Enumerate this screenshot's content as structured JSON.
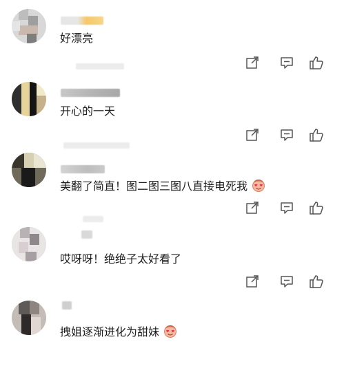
{
  "comments": [
    {
      "text": "好漂亮",
      "emoji": ""
    },
    {
      "text": "开心的一天",
      "emoji": ""
    },
    {
      "text": "美翻了简直！图二图三图八直接电死我",
      "emoji": "heart-eyes-emoji-icon"
    },
    {
      "text": "哎呀呀！绝绝子太好看了",
      "emoji": ""
    },
    {
      "text": "拽姐逐渐进化为甜妹",
      "emoji": "heart-eyes-emoji-icon"
    }
  ],
  "icons": {
    "share": "share-icon",
    "comment": "comment-icon",
    "like": "thumbs-up-icon"
  },
  "colors": {
    "icon_stroke": "#555555",
    "name_highlight": "#f6c86a"
  }
}
